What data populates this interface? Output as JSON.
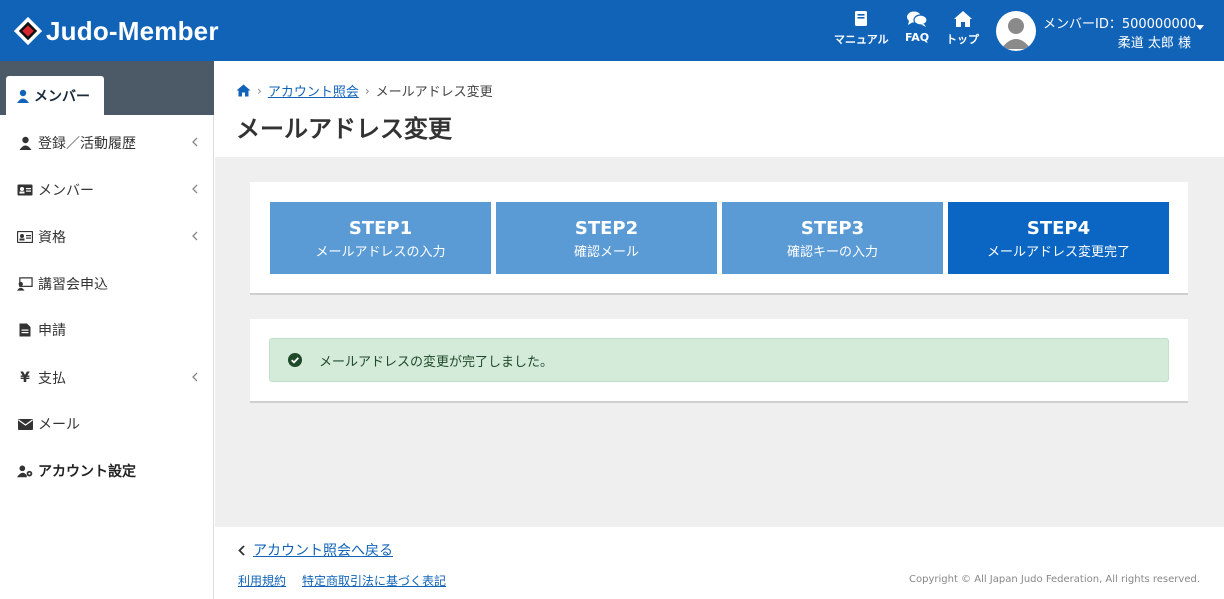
{
  "header": {
    "logo_text": "Judo-Member",
    "nav": [
      {
        "label": "マニュアル",
        "icon": "book-icon"
      },
      {
        "label": "FAQ",
        "icon": "chat-icon"
      },
      {
        "label": "トップ",
        "icon": "home-icon"
      }
    ],
    "member_id": "メンバーID：500000000",
    "member_name": "柔道 太郎 様"
  },
  "sidebar": {
    "tab_label": "メンバー",
    "items": [
      {
        "label": "登録／活動履歴",
        "icon": "user-icon"
      },
      {
        "label": "メンバー",
        "icon": "id-card-icon"
      },
      {
        "label": "資格",
        "icon": "certificate-icon"
      },
      {
        "label": "講習会申込",
        "icon": "lecture-icon"
      },
      {
        "label": "申請",
        "icon": "document-icon"
      },
      {
        "label": "支払",
        "icon": "yen-icon"
      },
      {
        "label": "メール",
        "icon": "envelope-icon"
      },
      {
        "label": "アカウント設定",
        "icon": "user-gear-icon"
      }
    ]
  },
  "breadcrumb": {
    "link": "アカウント照会",
    "current": "メールアドレス変更"
  },
  "page_title": "メールアドレス変更",
  "steps": [
    {
      "title": "STEP1",
      "subtitle": "メールアドレスの入力"
    },
    {
      "title": "STEP2",
      "subtitle": "確認メール"
    },
    {
      "title": "STEP3",
      "subtitle": "確認キーの入力"
    },
    {
      "title": "STEP4",
      "subtitle": "メールアドレス変更完了"
    }
  ],
  "current_step": 4,
  "alert_message": "メールアドレスの変更が完了しました。",
  "footer": {
    "back_link": "アカウント照会へ戻る",
    "terms": "利用規約",
    "commerce_law": "特定商取引法に基づく表記",
    "copyright": "Copyright © All Japan Judo Federation, All rights reserved."
  },
  "colors": {
    "header_bg": "#1163b8",
    "step_inactive": "#5b9bd5",
    "step_active": "#0a66c2",
    "alert_bg": "#d4ebd9"
  }
}
